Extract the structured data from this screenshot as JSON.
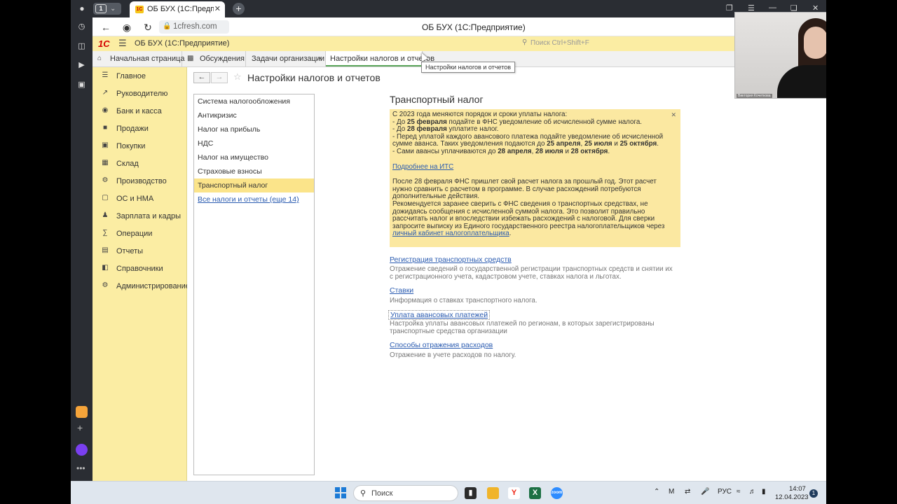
{
  "browser": {
    "tab_count": "1",
    "tab_title": "ОБ БУХ (1С:Предприятие)",
    "url": "1cfresh.com",
    "page_title": "ОБ БУХ (1С:Предприятие)"
  },
  "onec": {
    "logo": "1С",
    "app_title": "ОБ БУХ  (1С:Предприятие)",
    "search_placeholder": "Поиск Ctrl+Shift+F",
    "tabs": [
      {
        "label": "Начальная страница"
      },
      {
        "label": "Обсуждения"
      },
      {
        "label": "Задачи организации"
      },
      {
        "label": "Настройки налогов и отчетов"
      }
    ],
    "tooltip": "Настройки налогов и отчетов",
    "sections": [
      {
        "label": "Главное",
        "icon": "menu-icon"
      },
      {
        "label": "Руководителю",
        "icon": "chart-icon"
      },
      {
        "label": "Банк и касса",
        "icon": "bank-icon"
      },
      {
        "label": "Продажи",
        "icon": "bag-icon"
      },
      {
        "label": "Покупки",
        "icon": "cart-icon"
      },
      {
        "label": "Склад",
        "icon": "warehouse-icon"
      },
      {
        "label": "Производство",
        "icon": "factory-icon"
      },
      {
        "label": "ОС и НМА",
        "icon": "assets-icon"
      },
      {
        "label": "Зарплата и кадры",
        "icon": "person-icon"
      },
      {
        "label": "Операции",
        "icon": "operations-icon"
      },
      {
        "label": "Отчеты",
        "icon": "reports-icon"
      },
      {
        "label": "Справочники",
        "icon": "books-icon"
      },
      {
        "label": "Администрирование",
        "icon": "gear-icon"
      }
    ]
  },
  "form": {
    "title": "Настройки налогов и отчетов",
    "tax_list": [
      {
        "label": "Система налогообложения"
      },
      {
        "label": "Антикризис"
      },
      {
        "label": "Налог на прибыль"
      },
      {
        "label": "НДС"
      },
      {
        "label": "Налог на имущество"
      },
      {
        "label": "Страховые взносы"
      },
      {
        "label": "Транспортный налог"
      },
      {
        "label": "Все налоги и отчеты (еще 14)"
      }
    ],
    "section_title": "Транспортный налог",
    "notice": {
      "l1": "С 2023 года меняются порядок и сроки уплаты налога:",
      "l2a": " - До ",
      "l2b": "25 февраля",
      "l2c": " подайте в ФНС уведомление об исчисленной сумме налога.",
      "l3a": " - До ",
      "l3b": "28 февраля",
      "l3c": " уплатите налог.",
      "l4": " - Перед уплатой каждого авансового платежа подайте уведомление об исчисленной",
      "l5a": "сумме аванса. Таких уведомления подаются до ",
      "l5b": "25 апреля",
      "l5c": ", ",
      "l5d": "25 июля",
      "l5e": " и ",
      "l5f": "25 октября",
      "l5g": ".",
      "l6a": " - Сами авансы уплачиваются до ",
      "l6b": "28 апреля",
      "l6c": ", ",
      "l6d": "28 июля",
      "l6e": " и ",
      "l6f": "28 октября",
      "l6g": ".",
      "its_link": "Подробнее на ИТС",
      "p2": "После 28 февраля ФНС пришлет свой расчет налога за прошлый год. Этот расчет нужно сравнить с расчетом в программе. В случае расхождений потребуются дополнительные действия.",
      "p3": "Рекомендуется заранее сверить с ФНС сведения о транспортных средствах, не дожидаясь сообщения с исчисленной суммой налога. Это позволит правильно рассчитать налог и впоследствии избежать расхождений с налоговой. Для сверки запросите выписку из Единого государственного реестра налогоплательщиков через",
      "cabinet_link": "личный кабинет налогоплательщика",
      "dot": "."
    },
    "links": [
      {
        "label": "Регистрация транспортных средств",
        "desc": "Отражение сведений о государственной регистрации транспортных средств и снятии их с регистрационного учета, кадастровом учете, ставках налога и льготах."
      },
      {
        "label": "Ставки",
        "desc": "Информация о ставках транспортного налога."
      },
      {
        "label": "Уплата авансовых платежей",
        "desc": "Настройка уплаты авансовых платежей по регионам, в которых зарегистрированы транспортные средства организации"
      },
      {
        "label": "Способы отражения расходов",
        "desc": "Отражение в учете расходов по налогу."
      }
    ]
  },
  "taskbar": {
    "search_placeholder": "Поиск",
    "lang": "РУС",
    "time": "14:07",
    "date": "12.04.2023",
    "notifications": "1"
  },
  "webcam": {
    "name_caption": "Виктория Кочеткова"
  },
  "colors": {
    "onec_yellow": "#fbeda3",
    "notice_bg": "#fbe8a1",
    "selected": "#fbe48a",
    "link": "#2a5bb0"
  }
}
